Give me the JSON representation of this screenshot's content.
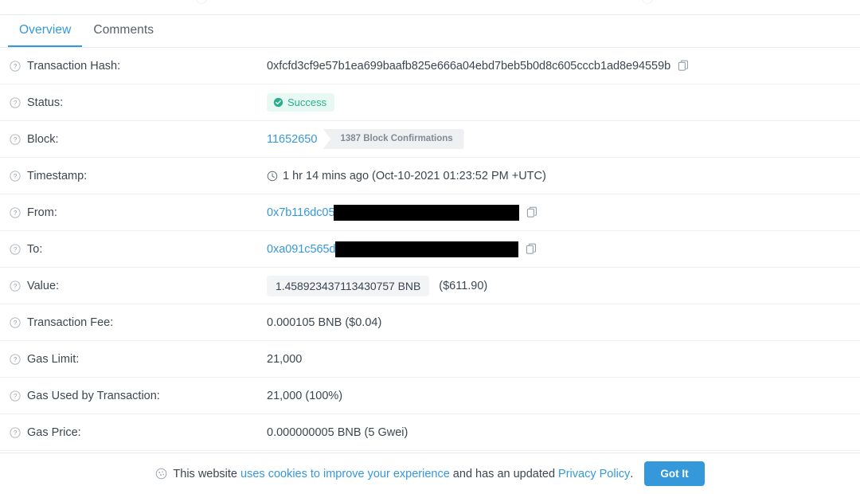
{
  "tabs": [
    {
      "label": "Overview",
      "active": true
    },
    {
      "label": "Comments",
      "active": false
    }
  ],
  "icons": {
    "help": "question-circle-icon",
    "copy": "copy-icon",
    "clock": "clock-icon",
    "check": "check-circle-icon",
    "cookie": "cookie-icon"
  },
  "colors": {
    "accent": "#3498db",
    "success_text": "#27b08b",
    "success_bg": "#e8f8f3",
    "badge_bg": "#eef0f2",
    "pill_bg": "#f3f4f6",
    "redaction": "#000000",
    "text": "#3c4650",
    "border": "#eef1f3"
  },
  "rows": {
    "transaction_hash": {
      "label": "Transaction Hash:",
      "value": "0xfcfd3cf9e57b1ea699baafb825e666a04ebd7beb5b0d8c605cccb1ad8e94559b"
    },
    "status": {
      "label": "Status:",
      "value": "Success"
    },
    "block": {
      "label": "Block:",
      "number": "11652650",
      "confirmations": "1387 Block Confirmations"
    },
    "timestamp": {
      "label": "Timestamp:",
      "value": "1 hr 14 mins ago (Oct-10-2021 01:23:52 PM +UTC)"
    },
    "from": {
      "label": "From:",
      "value_visible": "0x7b116dc05"
    },
    "to": {
      "label": "To:",
      "value_visible": "0xa091c565d"
    },
    "value": {
      "label": "Value:",
      "amount": "1.458923437113430757 BNB",
      "usd": "($611.90)"
    },
    "transaction_fee": {
      "label": "Transaction Fee:",
      "value": "0.000105 BNB ($0.04)"
    },
    "gas_limit": {
      "label": "Gas Limit:",
      "value": "21,000"
    },
    "gas_used": {
      "label": "Gas Used by Transaction:",
      "value": "21,000 (100%)"
    },
    "gas_price": {
      "label": "Gas Price:",
      "value": "0.000000005 BNB (5 Gwei)"
    }
  },
  "cookie_banner": {
    "text_start": "This website ",
    "link_1": "uses cookies to improve your experience",
    "text_middle": " and has an updated ",
    "link_2": "Privacy Policy",
    "text_end": ".",
    "button": "Got It"
  }
}
